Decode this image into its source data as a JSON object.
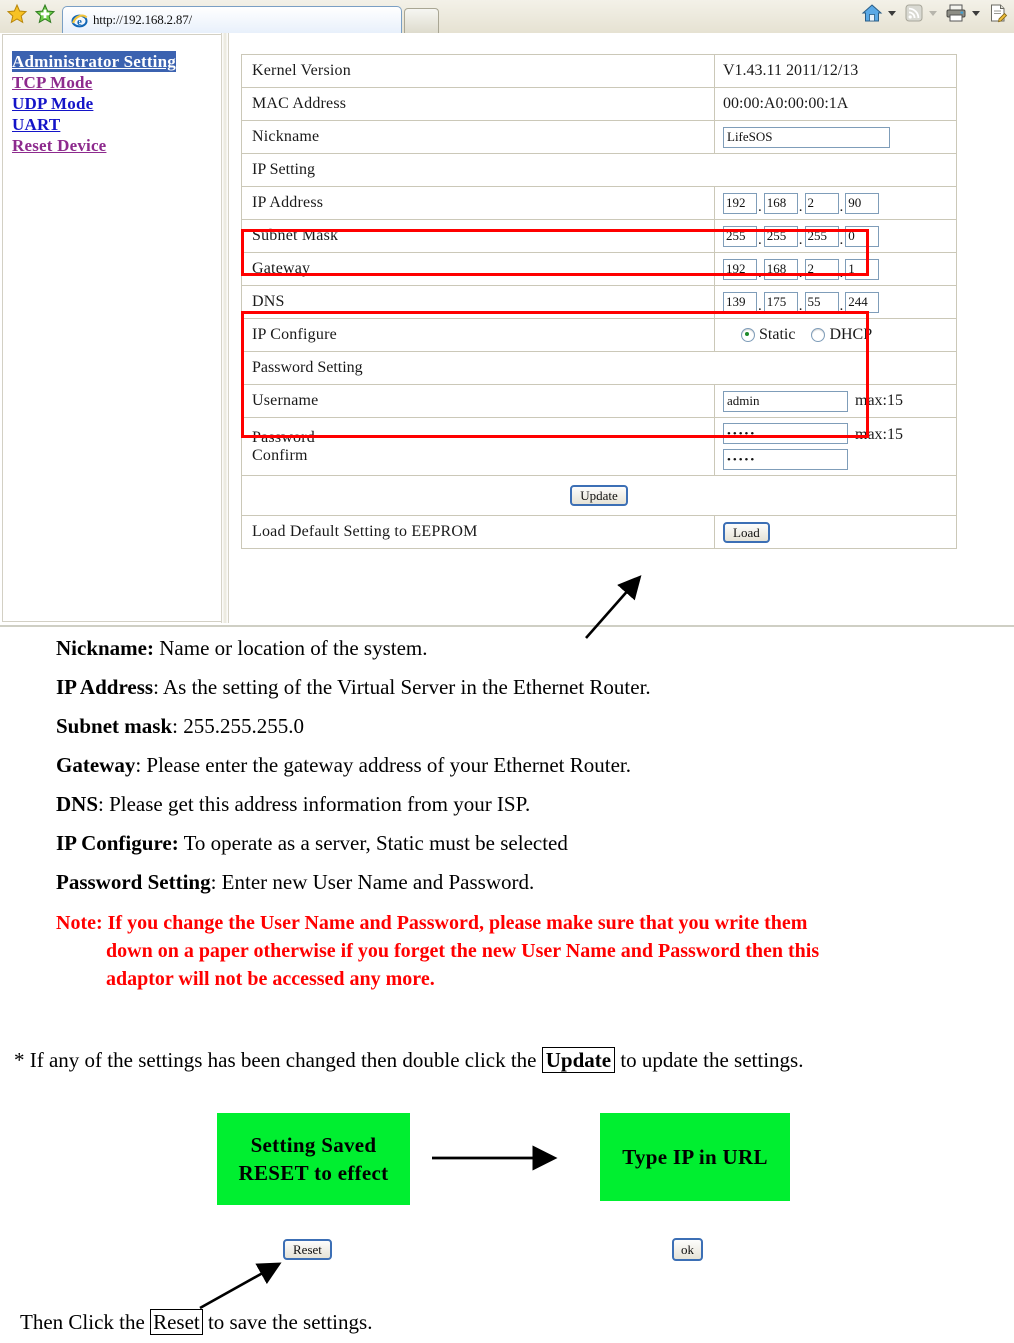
{
  "browser": {
    "url": "http://192.168.2.87/",
    "icons": {
      "favorites": "star-icon",
      "add_favorites": "add-favorite-icon",
      "ie_logo": "ie-logo-icon",
      "home": "home-icon",
      "feeds": "rss-feed-icon",
      "print": "printer-icon",
      "page": "page-edit-icon"
    }
  },
  "sidebar": {
    "items": [
      {
        "label": "Administrator Setting",
        "state": "selected"
      },
      {
        "label": "TCP Mode",
        "state": "visited"
      },
      {
        "label": "UDP Mode",
        "state": "link"
      },
      {
        "label": "UART",
        "state": "link"
      },
      {
        "label": "Reset Device",
        "state": "visited"
      }
    ]
  },
  "settings": {
    "kernel_version": {
      "label": "Kernel Version",
      "value": "V1.43.11 2011/12/13"
    },
    "mac_address": {
      "label": "MAC Address",
      "value": "00:00:A0:00:00:1A"
    },
    "nickname": {
      "label": "Nickname",
      "value": "LifeSOS"
    },
    "ip_setting_header": "IP Setting",
    "ip_address": {
      "label": "IP Address",
      "octets": [
        "192",
        "168",
        "2",
        "90"
      ]
    },
    "subnet_mask": {
      "label": "Subnet Mask",
      "octets": [
        "255",
        "255",
        "255",
        "0"
      ]
    },
    "gateway": {
      "label": "Gateway",
      "octets": [
        "192",
        "168",
        "2",
        "1"
      ]
    },
    "dns": {
      "label": "DNS",
      "octets": [
        "139",
        "175",
        "55",
        "244"
      ]
    },
    "ip_configure": {
      "label": "IP Configure",
      "options": [
        "Static",
        "DHCP"
      ],
      "selected": "Static"
    },
    "password_setting_header": "Password Setting",
    "username": {
      "label": "Username",
      "value": "admin",
      "max_hint": "max:15"
    },
    "password": {
      "label_line1": "Password",
      "label_line2": "Confirm",
      "value": "•••••",
      "confirm_value": "•••••",
      "max_hint": "max:15"
    },
    "update_button": "Update",
    "load_default": {
      "label": "Load Default Setting to EEPROM",
      "button": "Load"
    }
  },
  "explanations": [
    {
      "term": "Nickname:",
      "text": " Name or location of the system."
    },
    {
      "term": "IP Address",
      "text": ": As the setting of the Virtual Server in the Ethernet Router."
    },
    {
      "term": "Subnet mask",
      "text": ": 255.255.255.0"
    },
    {
      "term": "Gateway",
      "text": ": Please enter the gateway address of your Ethernet Router."
    },
    {
      "term": "DNS",
      "text": ": Please get this address information from your ISP."
    },
    {
      "term": "IP Configure:",
      "text": " To operate as a server, Static must be selected"
    },
    {
      "term": "Password Setting",
      "text": ": Enter new User Name and Password."
    }
  ],
  "note": {
    "line1": "Note: If you change the User Name and Password, please make sure that you write them",
    "line2": "down on a paper otherwise if you forget the new User Name and Password then this",
    "line3": "adaptor will not be accessed any more."
  },
  "update_instruction": {
    "prefix": "* If any of the settings has been changed then double click the ",
    "boxed": "Update",
    "suffix": " to update the settings."
  },
  "dialogs": {
    "saved": {
      "line1": "Setting Saved",
      "line2": "RESET to effect",
      "color": "#00ef30"
    },
    "type_ip": {
      "line1": "Type IP in URL",
      "color": "#00ef30"
    },
    "reset_button": "Reset",
    "ok_button": "ok"
  },
  "bottom_instruction": {
    "prefix": "Then Click the ",
    "boxed": "Reset",
    "suffix": " to save the settings."
  }
}
